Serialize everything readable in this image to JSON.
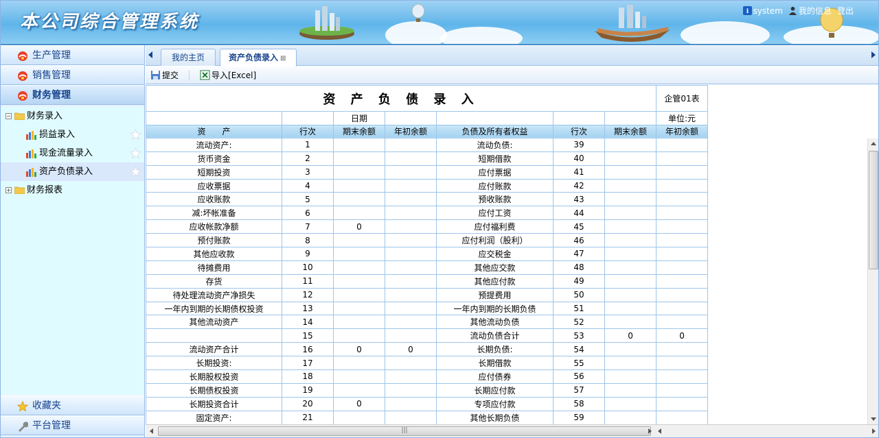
{
  "app": {
    "title": "本公司综合管理系统",
    "user_name": "system",
    "my_info": "我的信息",
    "logout": "登出"
  },
  "sidebar": {
    "top_sections": [
      {
        "label": "生产管理"
      },
      {
        "label": "销售管理"
      },
      {
        "label": "财务管理"
      }
    ],
    "tree": [
      {
        "label": "财务录入",
        "toggle": "⊟"
      },
      {
        "label": "损益录入"
      },
      {
        "label": "现金流量录入"
      },
      {
        "label": "资产负债录入"
      },
      {
        "label": "财务报表",
        "toggle": "⊞"
      }
    ],
    "bottom_sections": [
      {
        "label": "收藏夹"
      },
      {
        "label": "平台管理"
      }
    ]
  },
  "tabs": [
    {
      "label": "我的主页"
    },
    {
      "label": "资产负债录入"
    }
  ],
  "toolbar": {
    "submit": "提交",
    "import": "导入[Excel]"
  },
  "report": {
    "title": "资 产 负 债 录 入",
    "code": "企管01表",
    "date_label": "日期",
    "unit": "单位:元",
    "headers": [
      "资　　产",
      "行次",
      "期末余额",
      "年初余额",
      "负债及所有者权益",
      "行次",
      "期末余额",
      "年初余额"
    ],
    "rows": [
      [
        "流动资产:",
        "1",
        "",
        "",
        "流动负债:",
        "39",
        "",
        ""
      ],
      [
        "货币资金",
        "2",
        "",
        "",
        "短期借款",
        "40",
        "",
        ""
      ],
      [
        "短期投资",
        "3",
        "",
        "",
        "应付票据",
        "41",
        "",
        ""
      ],
      [
        "应收票据",
        "4",
        "",
        "",
        "应付账款",
        "42",
        "",
        ""
      ],
      [
        "应收账款",
        "5",
        "",
        "",
        "预收账款",
        "43",
        "",
        ""
      ],
      [
        "减:坏帐准备",
        "6",
        "",
        "",
        "应付工资",
        "44",
        "",
        ""
      ],
      [
        "应收帐款净额",
        "7",
        "0",
        "",
        "应付福利费",
        "45",
        "",
        ""
      ],
      [
        "预付账款",
        "8",
        "",
        "",
        "应付利润（股利）",
        "46",
        "",
        ""
      ],
      [
        "其他应收款",
        "9",
        "",
        "",
        "应交税金",
        "47",
        "",
        ""
      ],
      [
        "待摊费用",
        "10",
        "",
        "",
        "其他应交款",
        "48",
        "",
        ""
      ],
      [
        "存货",
        "11",
        "",
        "",
        "其他应付款",
        "49",
        "",
        ""
      ],
      [
        "待处理流动资产净损失",
        "12",
        "",
        "",
        "预提费用",
        "50",
        "",
        ""
      ],
      [
        "一年内到期的长期债权投资",
        "13",
        "",
        "",
        "一年内到期的长期负债",
        "51",
        "",
        ""
      ],
      [
        "其他流动资产",
        "14",
        "",
        "",
        "其他流动负债",
        "52",
        "",
        ""
      ],
      [
        "",
        "15",
        "",
        "",
        "流动负债合计",
        "53",
        "0",
        "0"
      ],
      [
        "流动资产合计",
        "16",
        "0",
        "0",
        "长期负债:",
        "54",
        "",
        ""
      ],
      [
        "长期投资:",
        "17",
        "",
        "",
        "长期借款",
        "55",
        "",
        ""
      ],
      [
        "长期股权投资",
        "18",
        "",
        "",
        "应付债券",
        "56",
        "",
        ""
      ],
      [
        "长期债权投资",
        "19",
        "",
        "",
        "长期应付款",
        "57",
        "",
        ""
      ],
      [
        "长期投资合计",
        "20",
        "0",
        "",
        "专项应付款",
        "58",
        "",
        ""
      ],
      [
        "固定资产:",
        "21",
        "",
        "",
        "其他长期负债",
        "59",
        "",
        ""
      ]
    ]
  },
  "colors": {
    "accent": "#15428b",
    "border": "#99bbe8",
    "table_border": "#9cc5e9",
    "header_bg": "#a4d2f0",
    "tree_bg": "#e0fbff"
  }
}
